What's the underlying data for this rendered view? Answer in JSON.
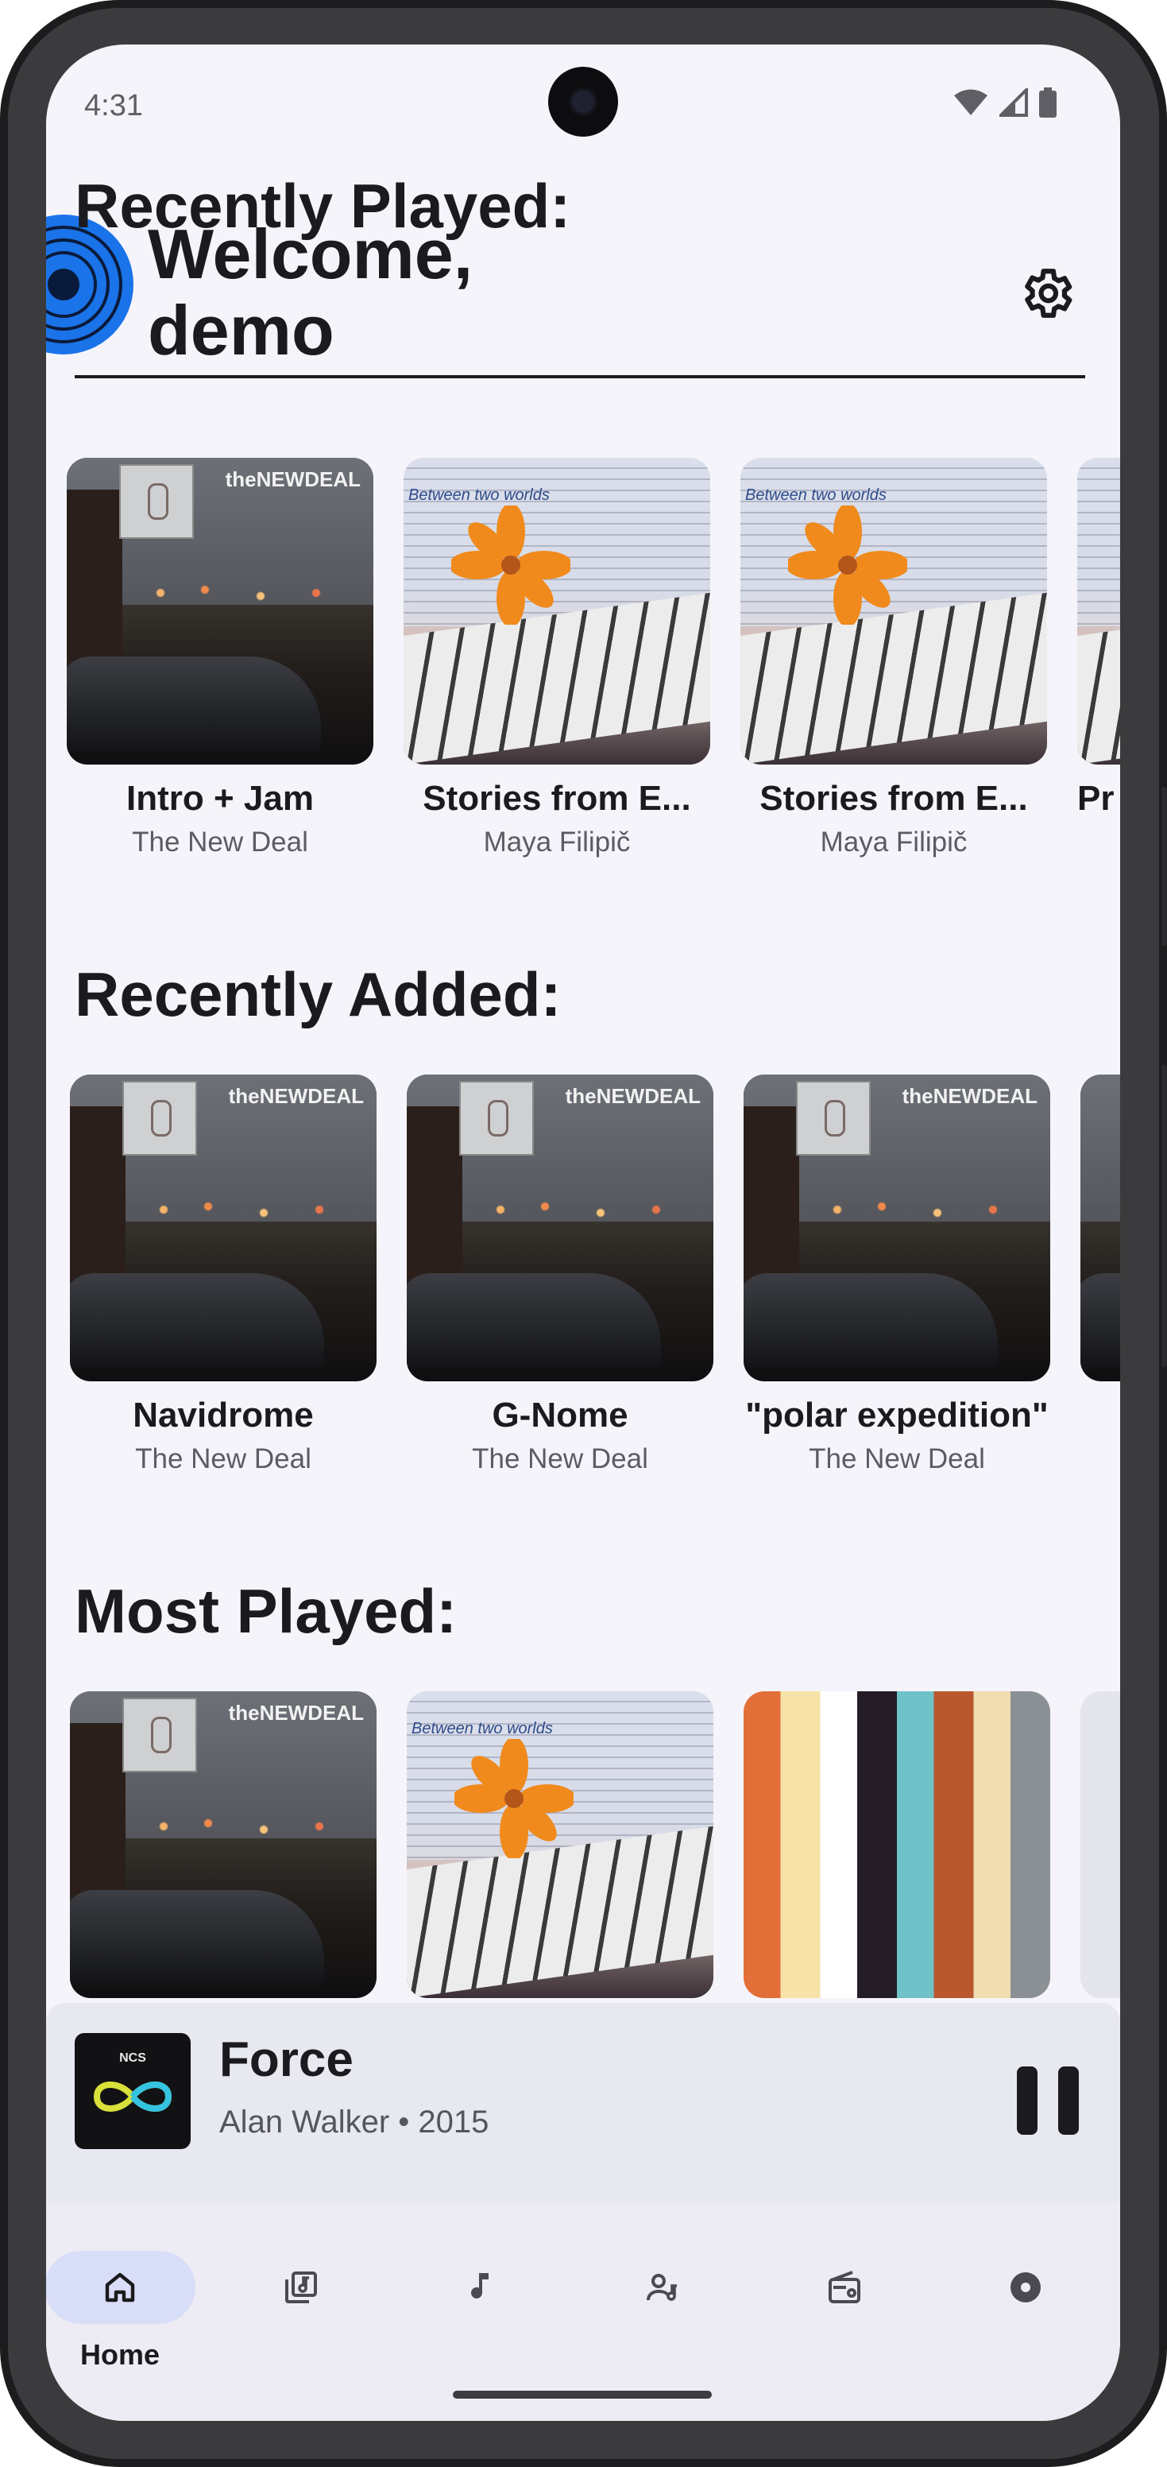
{
  "status_bar": {
    "time": "4:31"
  },
  "header": {
    "welcome_line1": "Welcome,",
    "welcome_line2": "demo"
  },
  "sections": {
    "recently_played": {
      "title": "Recently Played:",
      "items": [
        {
          "title": "Intro + Jam",
          "artist": "The New Deal",
          "art": "newdeal"
        },
        {
          "title": "Stories from E...",
          "artist": "Maya Filipič",
          "art": "piano"
        },
        {
          "title": "Stories from E...",
          "artist": "Maya Filipič",
          "art": "piano"
        },
        {
          "title": "Pr",
          "artist": "",
          "art": "piano"
        }
      ]
    },
    "recently_added": {
      "title": "Recently Added:",
      "items": [
        {
          "title": "Navidrome",
          "artist": "The New Deal",
          "art": "newdeal"
        },
        {
          "title": "G-Nome",
          "artist": "The New Deal",
          "art": "newdeal"
        },
        {
          "title": "\"polar expedition\"",
          "artist": "The New Deal",
          "art": "newdeal"
        }
      ]
    },
    "most_played": {
      "title": "Most Played:",
      "items": [
        {
          "art": "newdeal"
        },
        {
          "art": "piano"
        },
        {
          "art": "comic"
        }
      ]
    }
  },
  "art_text": {
    "newdeal_label": "theNEWDEAL",
    "piano_script": "Between two worlds"
  },
  "now_playing": {
    "title": "Force",
    "subtitle": "Alan Walker • 2015",
    "art_label": "NCS"
  },
  "nav": {
    "items": [
      {
        "label": "Home",
        "icon": "home-icon",
        "active": true
      },
      {
        "label": "",
        "icon": "library-icon"
      },
      {
        "label": "",
        "icon": "music-note-icon"
      },
      {
        "label": "",
        "icon": "artists-icon"
      },
      {
        "label": "",
        "icon": "radio-icon"
      },
      {
        "label": "",
        "icon": "disc-icon"
      }
    ]
  },
  "colors": {
    "accent": "#1a73e8",
    "background": "#f5f4fa",
    "nav_pill": "#d9def8"
  }
}
